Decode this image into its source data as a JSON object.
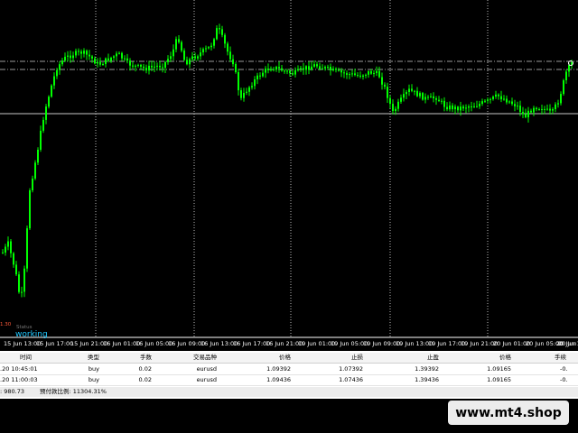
{
  "chart": {
    "x_labels": [
      "15 Jun 13:00",
      "15 Jun 17:00",
      "15 Jun 21:00",
      "16 Jun 01:00",
      "16 Jun 05:00",
      "16 Jun 09:00",
      "16 Jun 13:00",
      "16 Jun 17:00",
      "16 Jun 21:00",
      "19 Jun 01:00",
      "19 Jun 05:00",
      "19 Jun 09:00",
      "19 Jun 13:00",
      "19 Jun 17:00",
      "19 Jun 21:00",
      "20 Jun 01:00",
      "20 Jun 05:00",
      "20 Jun 09:00",
      "20 Jun 1"
    ],
    "corner_value": "1.30",
    "status_label": "Status",
    "status_value": "working",
    "colors": {
      "background": "#000000",
      "candle": "#00ff00",
      "grid": "#ffffff"
    }
  },
  "table": {
    "headers": {
      "time": "时间",
      "type": "类型",
      "lots": "手数",
      "symbol": "交易品种",
      "price": "价格",
      "sl": "止损",
      "tp": "止盈",
      "current_price": "价格",
      "commission": "手续"
    },
    "rows": [
      {
        "time": ".20 10:45:01",
        "type": "buy",
        "lots": "0.02",
        "symbol": "eurusd",
        "price": "1.09392",
        "sl": "1.07392",
        "tp": "1.39392",
        "current_price": "1.09165",
        "commission": "-0."
      },
      {
        "time": ".20 11:00:03",
        "type": "buy",
        "lots": "0.02",
        "symbol": "eurusd",
        "price": "1.09436",
        "sl": "1.07436",
        "tp": "1.39436",
        "current_price": "1.09165",
        "commission": "-0."
      }
    ],
    "summary": {
      "balance": ": 980.73",
      "margin_level": "预付款比例: 11304.31%"
    }
  },
  "watermark": {
    "text": "www.mt4.shop"
  }
}
